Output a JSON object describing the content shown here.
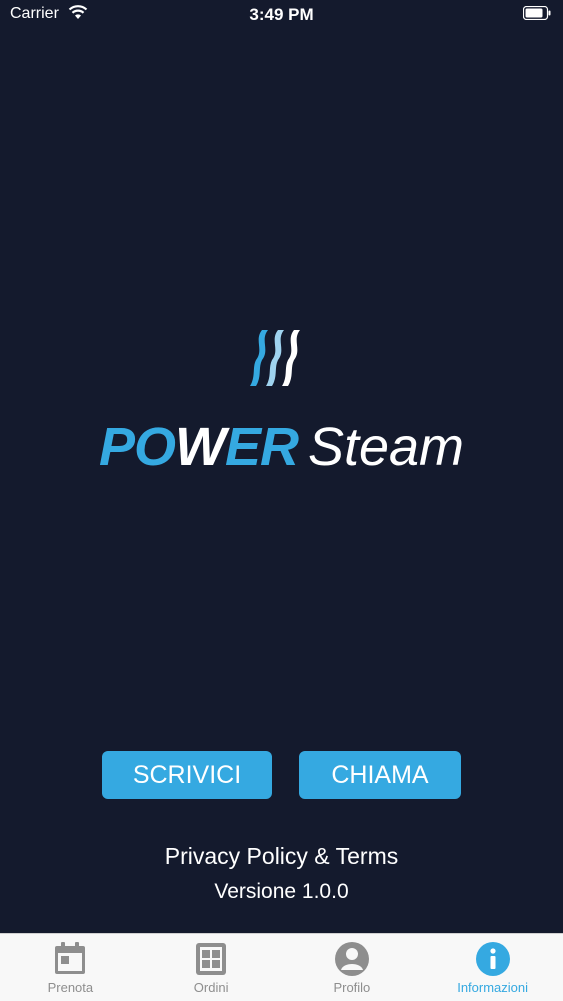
{
  "status": {
    "carrier": "Carrier",
    "time": "3:49 PM"
  },
  "brand": {
    "power_p": "PO",
    "power_w": "W",
    "power_er": "ER",
    "steam": "Steam"
  },
  "actions": {
    "write_label": "SCRIVICI",
    "call_label": "CHIAMA"
  },
  "footer": {
    "privacy": "Privacy Policy & Terms",
    "version": "Versione 1.0.0"
  },
  "tabs": [
    {
      "label": "Prenota",
      "icon": "calendar-icon"
    },
    {
      "label": "Ordini",
      "icon": "orders-icon"
    },
    {
      "label": "Profilo",
      "icon": "profile-icon"
    },
    {
      "label": "Informazioni",
      "icon": "info-icon",
      "active": true
    }
  ],
  "colors": {
    "accent": "#35a9e1",
    "background": "#141a2d",
    "tab_inactive": "#8e8e8e"
  }
}
